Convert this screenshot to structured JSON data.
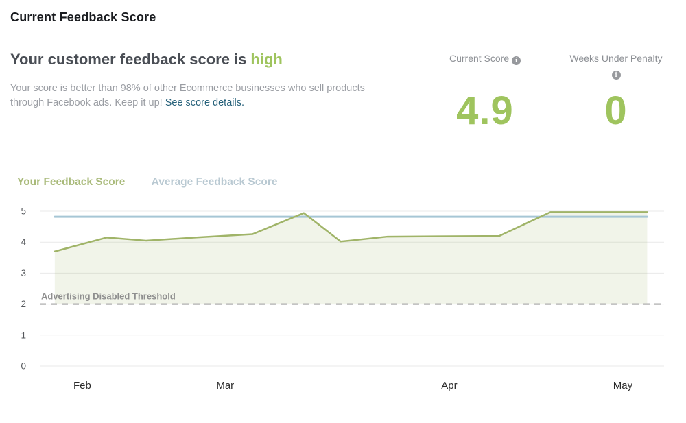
{
  "header": {
    "title": "Current Feedback Score",
    "heading_prefix": "Your customer feedback score is",
    "heading_status": "high",
    "description": "Your score is better than 98% of other Ecommerce businesses who sell products through Facebook ads. Keep it up!",
    "link_label": "See score details."
  },
  "stats": [
    {
      "label": "Current Score",
      "value": "4.9"
    },
    {
      "label": "Weeks Under Penalty",
      "value": "0"
    }
  ],
  "icons": {
    "info_glyph": "i"
  },
  "colors": {
    "accent_green": "#9fc45e",
    "link_teal": "#26617a",
    "heading_gray": "#4a4e55",
    "body_gray": "#9a9da3"
  },
  "chart_data": {
    "type": "line",
    "title": "",
    "xlabel": "",
    "ylabel": "",
    "grid": true,
    "legend_position": "top-left",
    "y_axis": {
      "min": 0,
      "max": 5,
      "ticks": [
        5,
        4,
        3,
        2,
        1,
        0
      ]
    },
    "x_axis": {
      "ticks": [
        {
          "label": "Feb",
          "pos": 0.068
        },
        {
          "label": "Mar",
          "pos": 0.297
        },
        {
          "label": "Apr",
          "pos": 0.656
        },
        {
          "label": "May",
          "pos": 0.934
        }
      ]
    },
    "threshold": {
      "value": 2,
      "label": "Advertising Disabled Threshold"
    },
    "series": [
      {
        "name": "Your Feedback Score",
        "color": "#a0b468",
        "legend_color": "#a9ba7a",
        "line_width": 2.5,
        "fill": "rgba(162,182,107,0.15)",
        "points": [
          {
            "x": 0.024,
            "y": 3.7
          },
          {
            "x": 0.107,
            "y": 4.15
          },
          {
            "x": 0.17,
            "y": 4.05
          },
          {
            "x": 0.249,
            "y": 4.15
          },
          {
            "x": 0.341,
            "y": 4.26
          },
          {
            "x": 0.423,
            "y": 4.94
          },
          {
            "x": 0.482,
            "y": 4.02
          },
          {
            "x": 0.557,
            "y": 4.18
          },
          {
            "x": 0.736,
            "y": 4.2
          },
          {
            "x": 0.818,
            "y": 4.97
          },
          {
            "x": 0.973,
            "y": 4.97
          }
        ]
      },
      {
        "name": "Average Feedback Score",
        "color": "#a6c6d5",
        "legend_color": "#b9c9d2",
        "line_width": 3,
        "points": [
          {
            "x": 0.024,
            "y": 4.82
          },
          {
            "x": 0.973,
            "y": 4.82
          }
        ]
      }
    ]
  }
}
